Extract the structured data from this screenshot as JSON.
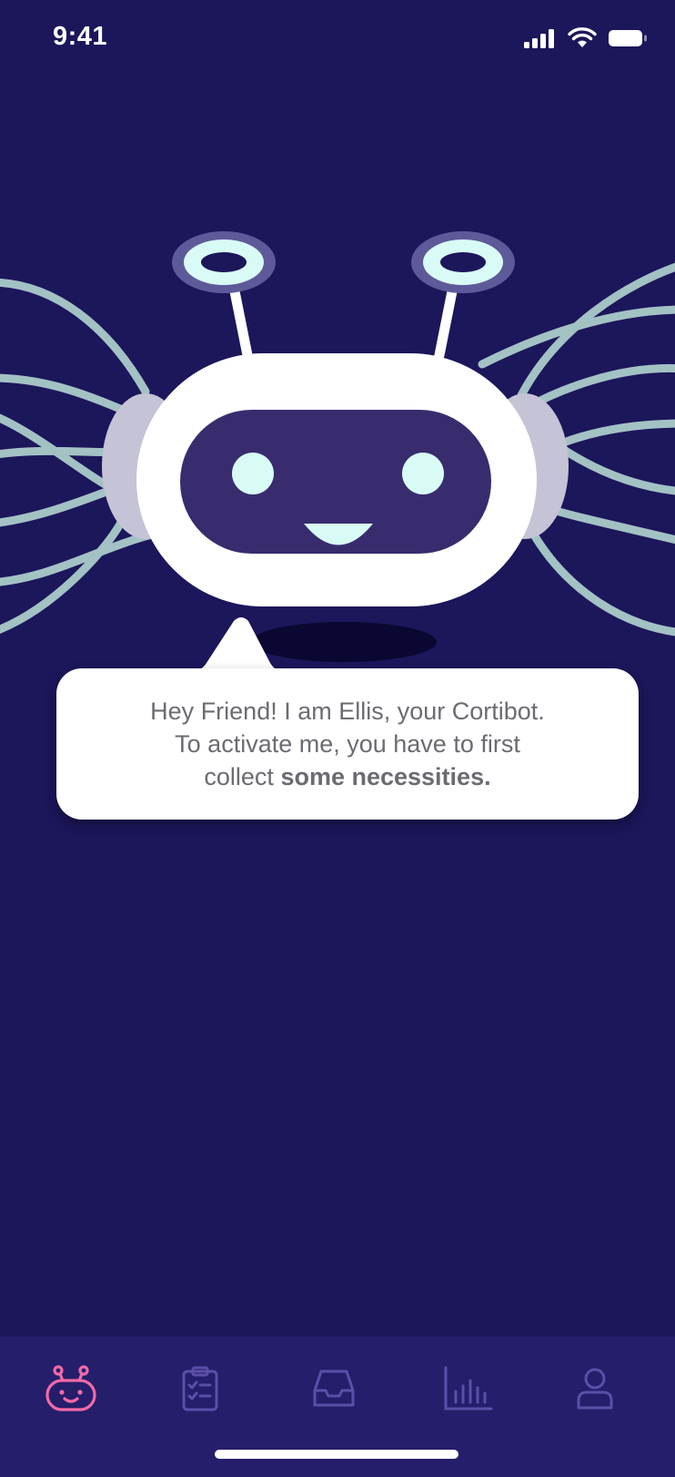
{
  "status_bar": {
    "time": "9:41",
    "icons": [
      "cellular-signal-icon",
      "wifi-icon",
      "battery-icon"
    ]
  },
  "bubble": {
    "line1": "Hey Friend! I am Ellis, your Cortibot.",
    "line2": "To activate me, you have to first",
    "line3_prefix": "collect ",
    "line3_bold": "some necessities."
  },
  "tab_bar": {
    "active_tab": "robot",
    "tabs": [
      {
        "icon": "robot-icon",
        "active": true
      },
      {
        "icon": "clipboard-checklist-icon",
        "active": false
      },
      {
        "icon": "inbox-tray-icon",
        "active": false
      },
      {
        "icon": "bar-chart-icon",
        "active": false
      },
      {
        "icon": "user-profile-icon",
        "active": false
      }
    ]
  },
  "colors": {
    "background": "#1c165b",
    "tab_bar_background": "#251e6b",
    "active_tab": "#f06aa8",
    "inactive_tab": "#5a4fa8",
    "robot_face_screen": "#382c6e",
    "robot_eyes": "#d9fbf6",
    "wires": "#a3c2c4",
    "bubble_text": "#6b6b72"
  }
}
